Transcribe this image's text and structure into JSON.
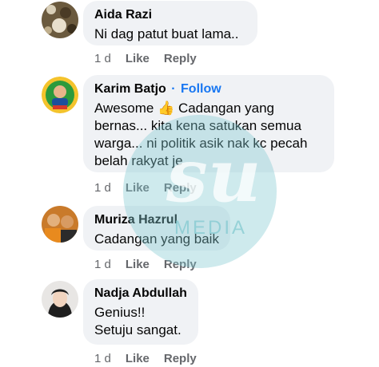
{
  "comments": [
    {
      "name": "Aida Razi",
      "text": "Ni dag patut buat lama..",
      "time": "1 d",
      "like": "Like",
      "reply": "Reply"
    },
    {
      "name": "Karim Batjo",
      "follow": "Follow",
      "text": "Awesome 👍 Cadangan yang\nbernas... kita kena satukan semua\nwarga... ni politik asik nak kc pecah\nbelah rakyat je",
      "time": "1 d",
      "like": "Like",
      "reply": "Reply"
    },
    {
      "name": "Muriza Hazrul",
      "text": "Cadangan yang baik",
      "time": "1 d",
      "like": "Like",
      "reply": "Reply"
    },
    {
      "name": "Nadja Abdullah",
      "text": "Genius!!\nSetuju sangat.",
      "time": "1 d",
      "like": "Like",
      "reply": "Reply"
    }
  ],
  "watermark": {
    "text": "MEDIA",
    "color": "#7fc8cf"
  },
  "colors": {
    "bubble": "#f0f2f5",
    "meta": "#65676b",
    "follow": "#1877f2"
  }
}
